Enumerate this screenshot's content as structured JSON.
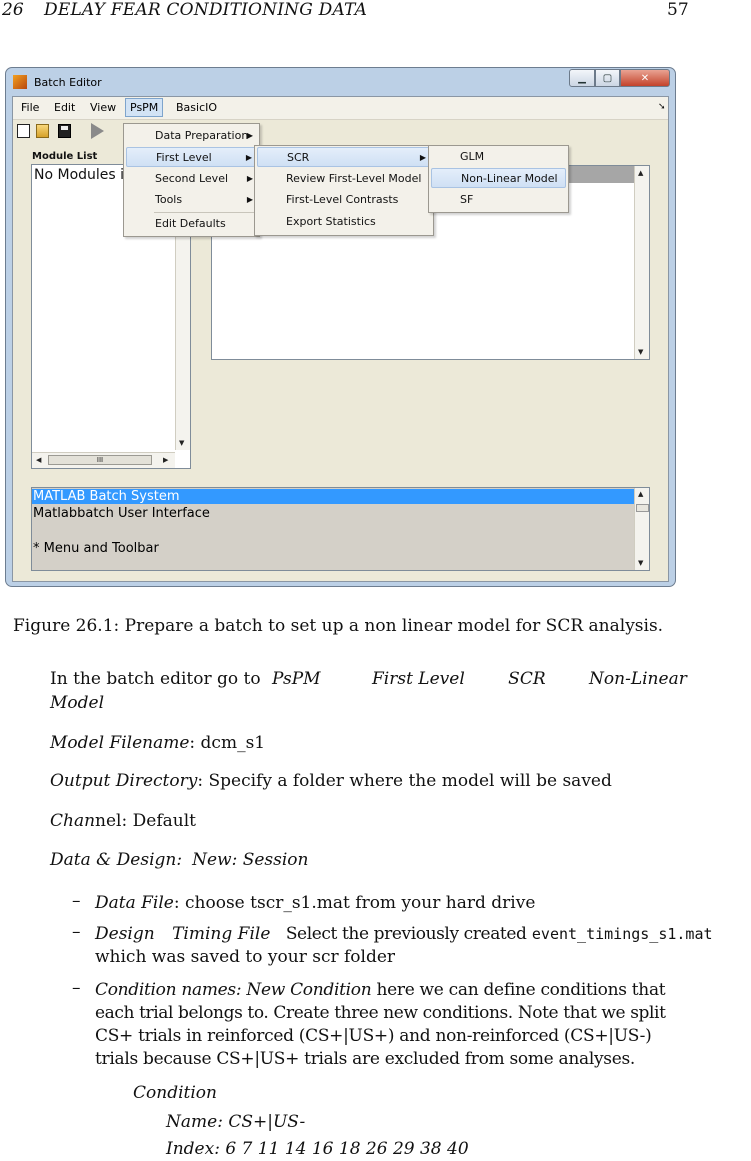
{
  "page_header": {
    "chapter_number": "26",
    "chapter_title": "DELAY FEAR CONDITIONING DATA",
    "page_number": "57"
  },
  "window": {
    "title": "Batch Editor",
    "menu": [
      "File",
      "Edit",
      "View",
      "PsPM",
      "BasicIO"
    ],
    "module_list_label": "Module List",
    "module_list_item": "No Modules i",
    "scroll_thumb_label": "III",
    "pspm_menu": [
      "Data Preparation",
      "First Level",
      "Second Level",
      "Tools",
      "Edit Defaults"
    ],
    "first_level_menu": [
      "SCR",
      "Review First-Level Model",
      "First-Level Contrasts",
      "Export Statistics"
    ],
    "scr_menu": [
      "GLM",
      "Non-Linear Model",
      "SF"
    ],
    "help_lines": [
      "MATLAB Batch System",
      "Matlabbatch User Interface",
      "* Menu and Toolbar"
    ]
  },
  "caption": "Figure 26.1: Prepare a batch to set up a non linear model for SCR analysis.",
  "body": {
    "step_intro": "In the batch editor go to",
    "path": [
      "PsPM",
      "First Level",
      "SCR",
      "Non-Linear"
    ],
    "path_cont": "Model",
    "model_filename_label": "Model Filename",
    "model_filename_value": ": dcm_s1",
    "output_dir_label": "Output Directory",
    "output_dir_value": ": Specify a folder where the model will be saved",
    "channel_label": "Chan",
    "channel_rest": "nel: Default",
    "data_design": "Data & Design:",
    "new_session": "New: Session",
    "items": {
      "data_file_label": "Data File",
      "data_file_value": ": choose tscr_s1.mat from your hard drive",
      "design_label": "Design",
      "timing_label": "Timing File",
      "design_value": "Select the previously created",
      "design_file": "event_timings_s1.mat",
      "design_cont": "which was saved to your scr folder",
      "cond_label": "Condition names: New Condition",
      "cond_lines": [
        "here we can define conditions that",
        "each trial belongs to. Create three new conditions. Note that we split",
        "CS+ trials in reinforced (CS+|US+) and non-reinforced (CS+|US-)",
        "trials because CS+|US+ trials are excluded from some analyses."
      ]
    },
    "condition_heading": "Condition",
    "condition_name": "Name: CS+|US-",
    "condition_index": "Index: 6 7 11 14 16 18 26 29 38 40"
  }
}
